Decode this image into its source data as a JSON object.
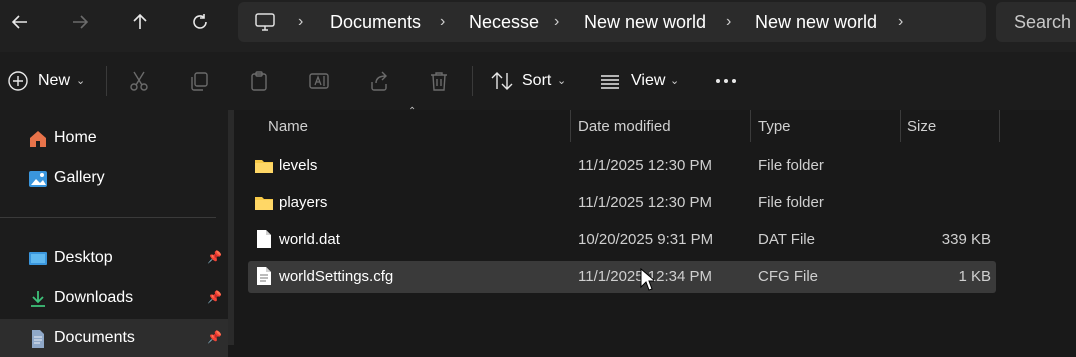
{
  "nav": {
    "back_icon": "arrow-left-icon",
    "forward_icon": "arrow-right-icon",
    "up_icon": "arrow-up-icon",
    "refresh_icon": "refresh-icon"
  },
  "address": {
    "icon": "computer-icon",
    "crumbs": [
      "Documents",
      "Necesse",
      "New new world",
      "New new world"
    ]
  },
  "search": {
    "placeholder": "Search N"
  },
  "toolbar": {
    "new_label": "New",
    "sort_label": "Sort",
    "view_label": "View"
  },
  "sidebar": {
    "items": [
      {
        "label": "Home",
        "icon": "home-icon"
      },
      {
        "label": "Gallery",
        "icon": "gallery-icon"
      },
      {
        "label": "Desktop",
        "icon": "desktop-icon",
        "pinned": true
      },
      {
        "label": "Downloads",
        "icon": "download-icon",
        "pinned": true
      },
      {
        "label": "Documents",
        "icon": "document-icon",
        "pinned": true,
        "selected": true
      }
    ]
  },
  "columns": {
    "name": "Name",
    "date": "Date modified",
    "type": "Type",
    "size": "Size"
  },
  "files": [
    {
      "name": "levels",
      "date": "11/1/2025 12:30 PM",
      "type": "File folder",
      "size": "",
      "icon": "folder-icon"
    },
    {
      "name": "players",
      "date": "11/1/2025 12:30 PM",
      "type": "File folder",
      "size": "",
      "icon": "folder-icon"
    },
    {
      "name": "world.dat",
      "date": "10/20/2025 9:31 PM",
      "type": "DAT File",
      "size": "339 KB",
      "icon": "file-icon"
    },
    {
      "name": "worldSettings.cfg",
      "date": "11/1/2025 12:34 PM",
      "type": "CFG File",
      "size": "1 KB",
      "icon": "text-file-icon",
      "selected": true
    }
  ],
  "colors": {
    "accent": "#0078d4",
    "folder": "#f7c948",
    "selection": "#3a3a3a"
  }
}
